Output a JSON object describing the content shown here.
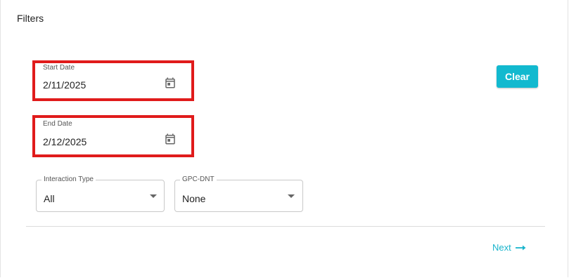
{
  "filters": {
    "title": "Filters",
    "start_date": {
      "label": "Start Date",
      "value": "2/11/2025",
      "icon": "calendar-icon"
    },
    "end_date": {
      "label": "End Date",
      "value": "2/12/2025",
      "icon": "calendar-icon"
    },
    "interaction_type": {
      "label": "Interaction Type",
      "value": "All"
    },
    "gpc_dnt": {
      "label": "GPC-DNT",
      "value": "None"
    },
    "clear_label": "Clear",
    "next_label": "Next",
    "next_icon": "arrow-right-icon"
  },
  "colors": {
    "accent": "#12b9cf",
    "highlight": "#e01b1b"
  }
}
